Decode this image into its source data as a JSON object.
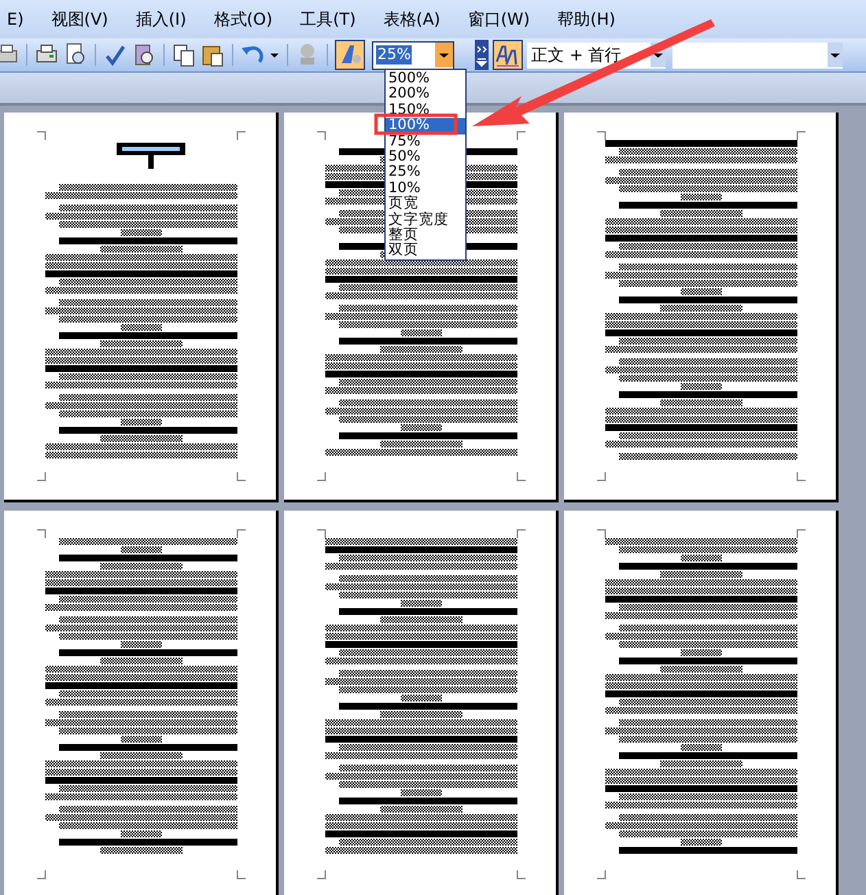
{
  "menu_bar": [
    {
      "label": "E)"
    },
    {
      "label": "视图(V)"
    },
    {
      "label": "插入(I)"
    },
    {
      "label": "格式(O)"
    },
    {
      "label": "工具(T)"
    },
    {
      "label": "表格(A)"
    },
    {
      "label": "窗口(W)"
    },
    {
      "label": "帮助(H)"
    }
  ],
  "toolbar": {
    "zoom_value": "25%",
    "style_value": "正文 + 首行"
  },
  "zoom_options": [
    {
      "label": "500%",
      "selected": false
    },
    {
      "label": "200%",
      "selected": false
    },
    {
      "label": "150%",
      "selected": false
    },
    {
      "label": "100%",
      "selected": true
    },
    {
      "label": "75%",
      "selected": false
    },
    {
      "label": "50%",
      "selected": false
    },
    {
      "label": "25%",
      "selected": false
    },
    {
      "label": "10%",
      "selected": false
    },
    {
      "label": "页宽",
      "selected": false
    },
    {
      "label": "文字宽度",
      "selected": false
    },
    {
      "label": "整页",
      "selected": false
    },
    {
      "label": "双页",
      "selected": false
    }
  ],
  "pages": [
    {
      "title_block": true
    },
    {
      "title_block": false
    },
    {
      "title_block": false
    },
    {
      "title_block": false
    },
    {
      "title_block": false
    },
    {
      "title_block": false
    }
  ]
}
